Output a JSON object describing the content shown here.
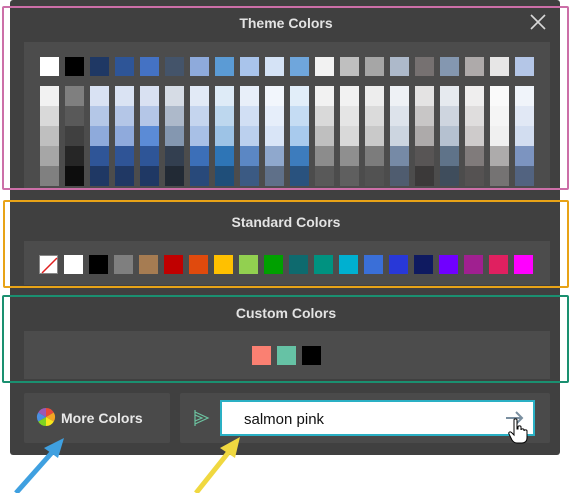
{
  "theme": {
    "title": "Theme Colors",
    "top_row": [
      "#ffffff",
      "#000000",
      "#1f3864",
      "#2e5597",
      "#4472c4",
      "#44546a",
      "#8eaadb",
      "#5b9bd5",
      "#a9c4eb",
      "#d5e3f6",
      "#6fa6dc",
      "#f2f2f2",
      "#bfbfbf",
      "#a6a6a6",
      "#adb9ca",
      "#767171",
      "#8497b0",
      "#aeaaaa",
      "#e7e6e6",
      "#b4c6e7"
    ],
    "columns": [
      [
        "#f2f2f2",
        "#d9d9d9",
        "#bfbfbf",
        "#a6a6a6",
        "#808080"
      ],
      [
        "#7f7f7f",
        "#595959",
        "#404040",
        "#262626",
        "#0d0d0d"
      ],
      [
        "#d9e2f3",
        "#b4c7e7",
        "#8eaadb",
        "#2f5597",
        "#1f3864"
      ],
      [
        "#dae3f3",
        "#b4c6e7",
        "#8faadc",
        "#2f5496",
        "#203864"
      ],
      [
        "#d9e1f2",
        "#b4c6e7",
        "#5b8bd6",
        "#2e5597",
        "#1f3864"
      ],
      [
        "#d6dce5",
        "#adb9ca",
        "#8497b0",
        "#333f50",
        "#222a35"
      ],
      [
        "#e2eaf6",
        "#c5d5ee",
        "#a8c0e6",
        "#3c6fb8",
        "#28497a"
      ],
      [
        "#deebf7",
        "#bdd7ee",
        "#9dc3e6",
        "#2e75b6",
        "#1f4e79"
      ],
      [
        "#e8eff9",
        "#d1dff4",
        "#bbd0ee",
        "#5b87c4",
        "#3b5a83"
      ],
      [
        "#f2f6fc",
        "#e6eefa",
        "#d9e5f7",
        "#8fa8cd",
        "#5f7089"
      ],
      [
        "#e2eef9",
        "#c5dcf3",
        "#a8caed",
        "#3d7cbd",
        "#29527e"
      ],
      [
        "#f2f2f2",
        "#d9d9d9",
        "#bfbfbf",
        "#8c8c8c",
        "#595959"
      ],
      [
        "#f2f2f2",
        "#e5e5e5",
        "#d9d9d9",
        "#8f8f8f",
        "#5f5f5f"
      ],
      [
        "#ededed",
        "#dbdbdb",
        "#c9c9c9",
        "#7c7c7c",
        "#525252"
      ],
      [
        "#eef1f5",
        "#dde3eb",
        "#ccd5e0",
        "#768aa6",
        "#4f5c6f"
      ],
      [
        "#e4e3e3",
        "#c8c6c6",
        "#adaaaa",
        "#585555",
        "#3b3939"
      ],
      [
        "#e6eaef",
        "#ced5df",
        "#b5c1d0",
        "#5f7389",
        "#3f4d5c"
      ],
      [
        "#efeeee",
        "#dfdddd",
        "#cecbcb",
        "#807b7b",
        "#555252"
      ],
      [
        "#fafafa",
        "#f5f5f5",
        "#f0f0f0",
        "#adabab",
        "#757373"
      ],
      [
        "#f0f4fa",
        "#e1e8f5",
        "#d2ddf0",
        "#7c94c0",
        "#526380"
      ]
    ]
  },
  "standard": {
    "title": "Standard Colors",
    "colors": [
      "none",
      "#ffffff",
      "#000000",
      "#7f7f7f",
      "#a67c52",
      "#c00000",
      "#e04a0d",
      "#ffc000",
      "#92d050",
      "#00a000",
      "#0e6a6e",
      "#009280",
      "#00b0d0",
      "#3a6fd8",
      "#2838d8",
      "#0f1a60",
      "#7000ff",
      "#a02090",
      "#e02060",
      "#ff00ff"
    ]
  },
  "custom": {
    "title": "Custom Colors",
    "colors": [
      "#fa8072",
      "#66c2a5",
      "#000000"
    ]
  },
  "more_colors": {
    "label": "More Colors"
  },
  "name_input": {
    "value": "salmon pink"
  },
  "accents": {
    "theme_outline": "#cc6fa8",
    "standard_outline": "#e8a317",
    "custom_outline": "#1a9070",
    "blue_arrow": "#3fa0e0",
    "yellow_arrow": "#f0d840",
    "input_border": "#2ab0c4"
  },
  "icons": {
    "close": "close-icon",
    "color_wheel": "color-wheel-icon",
    "name_picker": "color-name-icon",
    "submit_arrow": "arrow-right-icon",
    "cursor": "hand-cursor-icon"
  }
}
